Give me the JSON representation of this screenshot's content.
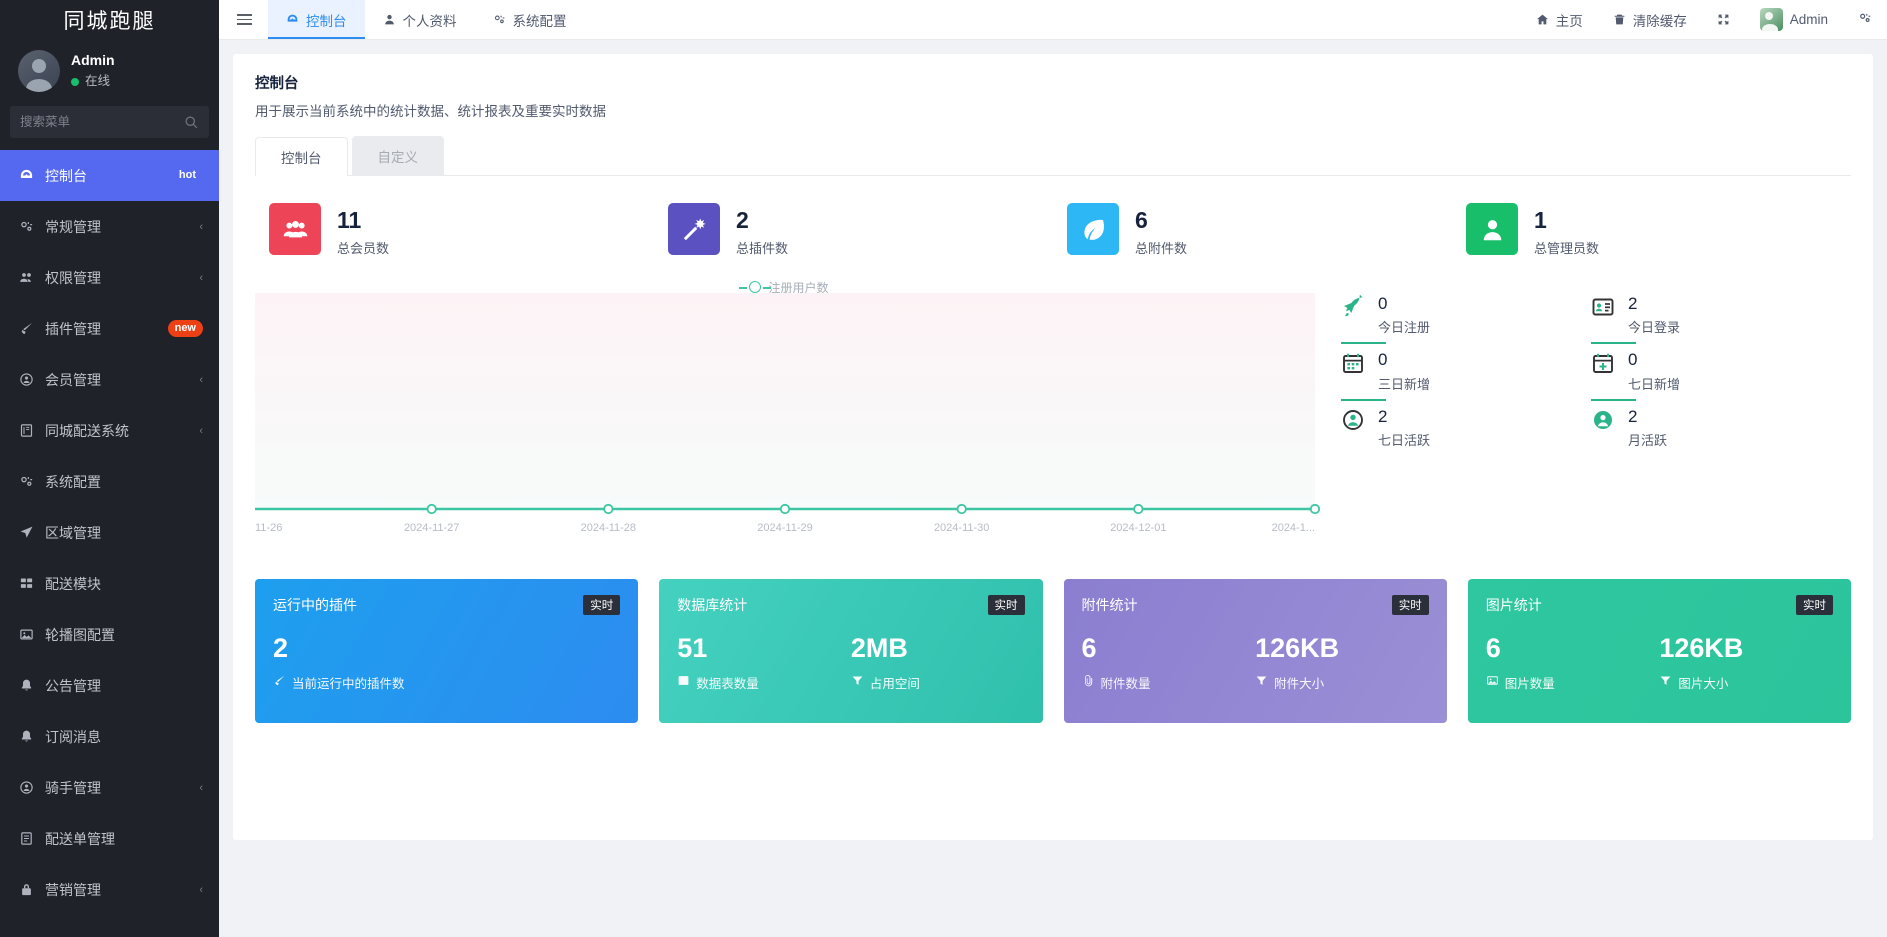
{
  "sidebar": {
    "brand": "同城跑腿",
    "user": {
      "name": "Admin",
      "status": "在线"
    },
    "search_placeholder": "搜索菜单",
    "items": [
      {
        "label": "控制台",
        "icon": "dashboard-icon",
        "badge": "hot",
        "badge_type": "hot",
        "active": true,
        "arrow": false
      },
      {
        "label": "常规管理",
        "icon": "cog-icon",
        "badge": "",
        "badge_type": "",
        "active": false,
        "arrow": true
      },
      {
        "label": "权限管理",
        "icon": "users-icon",
        "badge": "",
        "badge_type": "",
        "active": false,
        "arrow": true
      },
      {
        "label": "插件管理",
        "icon": "plug-icon",
        "badge": "new",
        "badge_type": "new",
        "active": false,
        "arrow": false
      },
      {
        "label": "会员管理",
        "icon": "user-circle-icon",
        "badge": "",
        "badge_type": "",
        "active": false,
        "arrow": true
      },
      {
        "label": "同城配送系统",
        "icon": "book-icon",
        "badge": "",
        "badge_type": "",
        "active": false,
        "arrow": true
      },
      {
        "label": "系统配置",
        "icon": "cog-icon",
        "badge": "",
        "badge_type": "",
        "active": false,
        "arrow": false
      },
      {
        "label": "区域管理",
        "icon": "location-icon",
        "badge": "",
        "badge_type": "",
        "active": false,
        "arrow": false
      },
      {
        "label": "配送模块",
        "icon": "grid-icon",
        "badge": "",
        "badge_type": "",
        "active": false,
        "arrow": false
      },
      {
        "label": "轮播图配置",
        "icon": "image-icon",
        "badge": "",
        "badge_type": "",
        "active": false,
        "arrow": false
      },
      {
        "label": "公告管理",
        "icon": "bell-icon",
        "badge": "",
        "badge_type": "",
        "active": false,
        "arrow": false
      },
      {
        "label": "订阅消息",
        "icon": "bell-icon",
        "badge": "",
        "badge_type": "",
        "active": false,
        "arrow": false
      },
      {
        "label": "骑手管理",
        "icon": "user-circle-icon",
        "badge": "",
        "badge_type": "",
        "active": false,
        "arrow": true
      },
      {
        "label": "配送单管理",
        "icon": "order-icon",
        "badge": "",
        "badge_type": "",
        "active": false,
        "arrow": false
      },
      {
        "label": "营销管理",
        "icon": "lock-icon",
        "badge": "",
        "badge_type": "",
        "active": false,
        "arrow": true
      }
    ]
  },
  "topbar": {
    "tabs": [
      {
        "label": "控制台",
        "icon": "dashboard-icon",
        "active": true
      },
      {
        "label": "个人资料",
        "icon": "user-icon",
        "active": false
      },
      {
        "label": "系统配置",
        "icon": "cog-icon",
        "active": false
      }
    ],
    "actions": [
      {
        "label": "主页",
        "icon": "home-icon"
      },
      {
        "label": "清除缓存",
        "icon": "trash-icon"
      },
      {
        "label": "",
        "icon": "fullscreen-icon"
      }
    ],
    "account_name": "Admin",
    "settings_icon": "gear-icon"
  },
  "page": {
    "title": "控制台",
    "description": "用于展示当前系统中的统计数据、统计报表及重要实时数据",
    "tabs": [
      {
        "label": "控制台",
        "active": true
      },
      {
        "label": "自定义",
        "active": false
      }
    ]
  },
  "stats": [
    {
      "value": "11",
      "label": "总会员数",
      "color": "#ed4457",
      "icon": "group-icon"
    },
    {
      "value": "2",
      "label": "总插件数",
      "color": "#5b51c0",
      "icon": "magic-wand-icon"
    },
    {
      "value": "6",
      "label": "总附件数",
      "color": "#2db7f5",
      "icon": "leaf-icon"
    },
    {
      "value": "1",
      "label": "总管理员数",
      "color": "#19be6b",
      "icon": "user-solid-icon"
    }
  ],
  "chart_data": {
    "type": "line",
    "title": "",
    "legend": [
      "注册用户数"
    ],
    "legend_position": "top-center",
    "xlabel": "",
    "ylabel": "",
    "grid": false,
    "x": [
      "11-26",
      "2024-11-27",
      "2024-11-28",
      "2024-11-29",
      "2024-11-30",
      "2024-12-01",
      "2024-1..."
    ],
    "series": [
      {
        "name": "注册用户数",
        "values": [
          0,
          0,
          0,
          0,
          0,
          0,
          0
        ],
        "color": "#3ec6a4"
      }
    ],
    "ylim": [
      0,
      1
    ]
  },
  "metrics": [
    {
      "value": "0",
      "label": "今日注册",
      "icon": "rocket-icon",
      "divider": true
    },
    {
      "value": "2",
      "label": "今日登录",
      "icon": "id-card-icon",
      "divider": true
    },
    {
      "value": "0",
      "label": "三日新增",
      "icon": "calendar-icon",
      "divider": true
    },
    {
      "value": "0",
      "label": "七日新增",
      "icon": "calendar-plus-icon",
      "divider": true
    },
    {
      "value": "2",
      "label": "七日活跃",
      "icon": "user-active-icon",
      "divider": false
    },
    {
      "value": "2",
      "label": "月活跃",
      "icon": "user-month-icon",
      "divider": false
    }
  ],
  "bottom_cards": [
    {
      "title": "运行中的插件",
      "tag": "实时",
      "color_from": "#1e9fee",
      "color_to": "#2d8cf0",
      "entries": [
        {
          "value": "2",
          "label": "当前运行中的插件数",
          "icon": "plug-icon"
        }
      ]
    },
    {
      "title": "数据库统计",
      "tag": "实时",
      "color_from": "#45d1c0",
      "color_to": "#2fc0ac",
      "entries": [
        {
          "value": "51",
          "label": "数据表数量",
          "icon": "table-icon"
        },
        {
          "value": "2MB",
          "label": "占用空间",
          "icon": "filter-icon"
        }
      ]
    },
    {
      "title": "附件统计",
      "tag": "实时",
      "color_from": "#8b7ed0",
      "color_to": "#9b8fd6",
      "entries": [
        {
          "value": "6",
          "label": "附件数量",
          "icon": "paperclip-icon"
        },
        {
          "value": "126KB",
          "label": "附件大小",
          "icon": "filter-icon"
        }
      ]
    },
    {
      "title": "图片统计",
      "tag": "实时",
      "color_from": "#2fc79f",
      "color_to": "#2bc49b",
      "entries": [
        {
          "value": "6",
          "label": "图片数量",
          "icon": "image-icon"
        },
        {
          "value": "126KB",
          "label": "图片大小",
          "icon": "filter-icon"
        }
      ]
    }
  ],
  "colors": {
    "sidebar_bg": "#20222a",
    "accent": "#5468f0",
    "topbar_accent": "#2d8cf0",
    "online": "#19be6b",
    "metric_line": "#2bb48a"
  }
}
